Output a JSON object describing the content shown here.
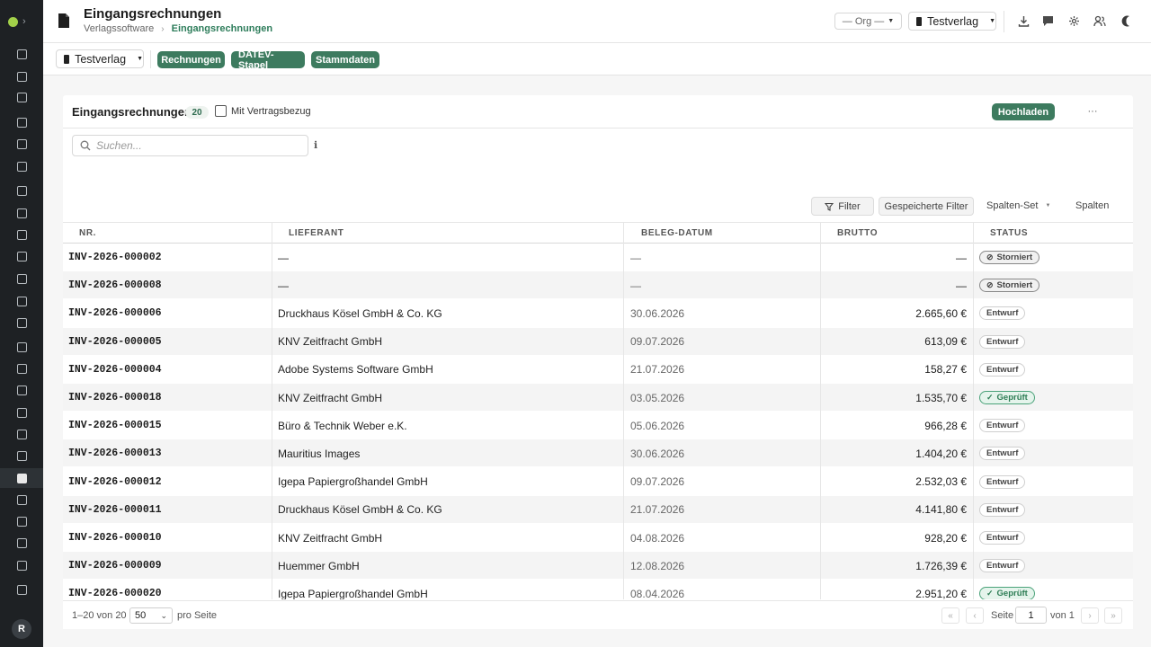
{
  "app": {
    "title": "Eingangsrechnungen",
    "breadcrumb": [
      "Verlagssoftware",
      "Eingangsrechnungen"
    ]
  },
  "header": {
    "org_select": "— Org —",
    "verlag_select": "Testverlag",
    "user_initial": "R"
  },
  "header_icons": [
    "download-icon",
    "comment-icon",
    "tools-icon",
    "users-icon",
    "moon-icon"
  ],
  "sidebar_icons": [
    "refresh-icon",
    "calendar-icon",
    "grid-icon",
    "user-edit-icon",
    "stack-icon",
    "send-icon",
    "bulb-icon",
    "library-icon",
    "image-icon",
    "box-icon",
    "media-icon",
    "scroll-icon",
    "feather-icon",
    "truck-icon",
    "circle-icon",
    "briefcase-icon",
    "megaphone-icon",
    "bus-icon",
    "music-icon",
    "invoice-icon",
    "warehouse-icon",
    "transfer-icon",
    "chart-icon",
    "receipt-icon",
    "shield-icon"
  ],
  "sidebar_active": 19,
  "toolbar": {
    "verlag_select": "Testverlag",
    "tabs": [
      "Rechnungen",
      "DATEV-Stapel",
      "Stammdaten"
    ]
  },
  "card": {
    "title": "Eingangsrechnungen",
    "count": "20",
    "checkbox_label": "Mit Vertragsbezug",
    "upload_label": "Hochladen",
    "more_label": "···",
    "search_placeholder": "Suchen...",
    "info_glyph": "ℹ",
    "filter_label": "Filter",
    "saved_filter_label": "Gespeicherte Filter",
    "column_set_label": "Spalten-Set",
    "columns_label": "Spalten"
  },
  "table": {
    "columns": [
      "Nr.",
      "Lieferant",
      "Beleg-Datum",
      "Brutto",
      "Status"
    ],
    "rows": [
      {
        "nr": "INV-2026-000002",
        "lieferant": "—",
        "datum": "—",
        "brutto": "—",
        "status": "Storniert"
      },
      {
        "nr": "INV-2026-000008",
        "lieferant": "—",
        "datum": "—",
        "brutto": "—",
        "status": "Storniert"
      },
      {
        "nr": "INV-2026-000006",
        "lieferant": "Druckhaus Kösel GmbH & Co. KG",
        "datum": "30.06.2026",
        "brutto": "2.665,60 €",
        "status": "Entwurf"
      },
      {
        "nr": "INV-2026-000005",
        "lieferant": "KNV Zeitfracht GmbH",
        "datum": "09.07.2026",
        "brutto": "613,09 €",
        "status": "Entwurf"
      },
      {
        "nr": "INV-2026-000004",
        "lieferant": "Adobe Systems Software GmbH",
        "datum": "21.07.2026",
        "brutto": "158,27 €",
        "status": "Entwurf"
      },
      {
        "nr": "INV-2026-000018",
        "lieferant": "KNV Zeitfracht GmbH",
        "datum": "03.05.2026",
        "brutto": "1.535,70 €",
        "status": "Geprüft"
      },
      {
        "nr": "INV-2026-000015",
        "lieferant": "Büro & Technik Weber e.K.",
        "datum": "05.06.2026",
        "brutto": "966,28 €",
        "status": "Entwurf"
      },
      {
        "nr": "INV-2026-000013",
        "lieferant": "Mauritius Images",
        "datum": "30.06.2026",
        "brutto": "1.404,20 €",
        "status": "Entwurf"
      },
      {
        "nr": "INV-2026-000012",
        "lieferant": "Igepa Papiergroßhandel GmbH",
        "datum": "09.07.2026",
        "brutto": "2.532,03 €",
        "status": "Entwurf"
      },
      {
        "nr": "INV-2026-000011",
        "lieferant": "Druckhaus Kösel GmbH & Co. KG",
        "datum": "21.07.2026",
        "brutto": "4.141,80 €",
        "status": "Entwurf"
      },
      {
        "nr": "INV-2026-000010",
        "lieferant": "KNV Zeitfracht GmbH",
        "datum": "04.08.2026",
        "brutto": "928,20 €",
        "status": "Entwurf"
      },
      {
        "nr": "INV-2026-000009",
        "lieferant": "Huemmer GmbH",
        "datum": "12.08.2026",
        "brutto": "1.726,39 €",
        "status": "Entwurf"
      },
      {
        "nr": "INV-2026-000020",
        "lieferant": "Igepa Papiergroßhandel GmbH",
        "datum": "08.04.2026",
        "brutto": "2.951,20 €",
        "status": "Geprüft"
      }
    ]
  },
  "pagination": {
    "range": "1–20 von 20",
    "per_page": "50",
    "per_page_label": "pro Seite",
    "page_label": "Seite",
    "page": "1",
    "of_label": "von 1"
  },
  "colors": {
    "accent": "#3d7b5f",
    "sidebar_bg": "#1e2124",
    "badge_green": "#e5f4ec"
  }
}
